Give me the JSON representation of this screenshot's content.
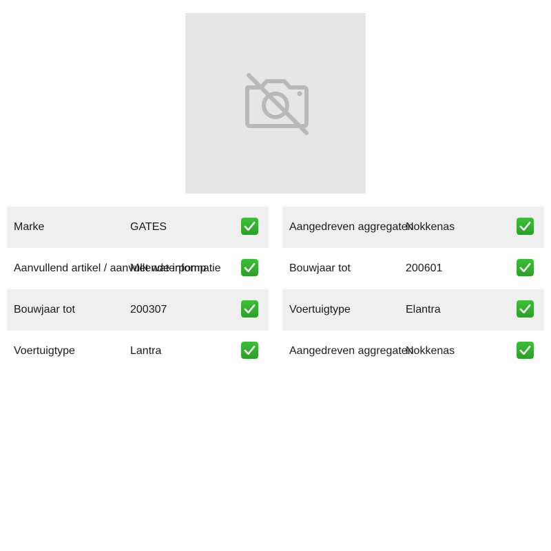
{
  "product_image": {
    "icon": "no-photo-icon"
  },
  "specs_left": [
    {
      "label": "Marke",
      "value": "GATES",
      "checked": true
    },
    {
      "label": "Aanvullend artikel / aanvullende informatie",
      "value": "Met waterpomp",
      "checked": true
    },
    {
      "label": "Bouwjaar tot",
      "value": "200307",
      "checked": true
    },
    {
      "label": "Voertuigtype",
      "value": "Lantra",
      "checked": true
    }
  ],
  "specs_right": [
    {
      "label": "Aangedreven aggregaten",
      "value": "Nokkenas",
      "checked": true
    },
    {
      "label": "Bouwjaar tot",
      "value": "200601",
      "checked": true
    },
    {
      "label": "Voertuigtype",
      "value": "Elantra",
      "checked": true
    },
    {
      "label": "Aangedreven aggregaten",
      "value": "Nokkenas",
      "checked": true
    }
  ],
  "colors": {
    "check_green": "#2e9e2b",
    "row_shade": "#efefef",
    "placeholder_bg": "#e6e6e6"
  }
}
